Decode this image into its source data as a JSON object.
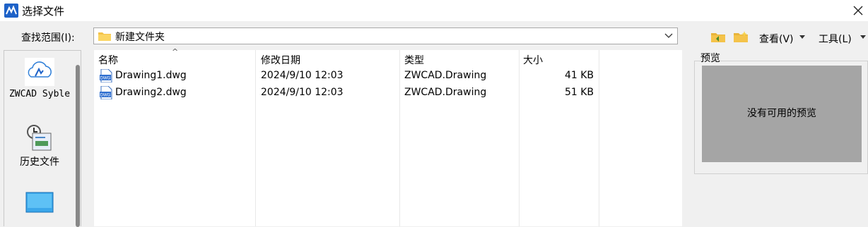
{
  "window": {
    "title": "选择文件",
    "close_symbol": "✕"
  },
  "lookin": {
    "label": "查找范围(I):",
    "path": "新建文件夹"
  },
  "toolbar": {
    "view_label": "查看(V)",
    "tools_label": "工具(L)"
  },
  "places": [
    {
      "label": "ZWCAD Syble",
      "icon": "cloud-icon"
    },
    {
      "label": "历史文件",
      "icon": "history-icon"
    },
    {
      "label": "",
      "icon": "desktop-icon"
    }
  ],
  "file_list": {
    "columns": [
      "名称",
      "修改日期",
      "类型",
      "大小"
    ],
    "sort_indicator": "^",
    "rows": [
      {
        "name": "Drawing1.dwg",
        "date": "2024/9/10 12:03",
        "type": "ZWCAD.Drawing",
        "size": "41 KB"
      },
      {
        "name": "Drawing2.dwg",
        "date": "2024/9/10 12:03",
        "type": "ZWCAD.Drawing",
        "size": "51 KB"
      }
    ]
  },
  "preview": {
    "label": "预览",
    "empty_text": "没有可用的预览"
  },
  "colors": {
    "accent": "#1e62c8",
    "folder": "#f4c34a",
    "preview_bg": "#a5a5a5"
  }
}
